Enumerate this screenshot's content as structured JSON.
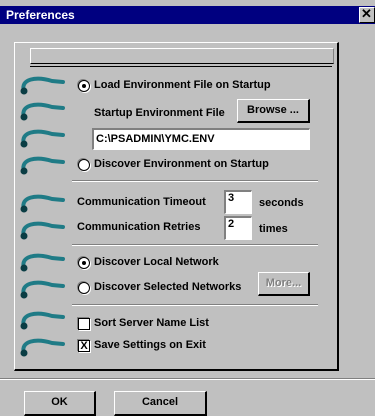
{
  "window": {
    "title": "Preferences",
    "close_glyph": "✕"
  },
  "environment": {
    "load_label": "Load Environment File on Startup",
    "load_selected": true,
    "file_label": "Startup Environment File",
    "browse_label": "Browse ...",
    "file_value": "C:\\PSADMIN\\YMC.ENV",
    "discover_label": "Discover Environment on Startup",
    "discover_selected": false
  },
  "communication": {
    "timeout_label": "Communication Timeout",
    "timeout_value": "3",
    "timeout_unit": "seconds",
    "retries_label": "Communication Retries",
    "retries_value": "2",
    "retries_unit": "times"
  },
  "network": {
    "local_label": "Discover Local Network",
    "local_selected": true,
    "selected_label": "Discover Selected Networks",
    "selected_selected": false,
    "more_label": "More..."
  },
  "options": {
    "sort_label": "Sort Server Name List",
    "sort_checked": false,
    "save_label": "Save Settings on Exit",
    "save_checked": true,
    "check_glyph": "X"
  },
  "buttons": {
    "ok_label": "OK",
    "cancel_label": "Cancel"
  },
  "colors": {
    "titlebar": "#000080",
    "face": "#c0c0c0",
    "ring": "#1f7b86"
  }
}
